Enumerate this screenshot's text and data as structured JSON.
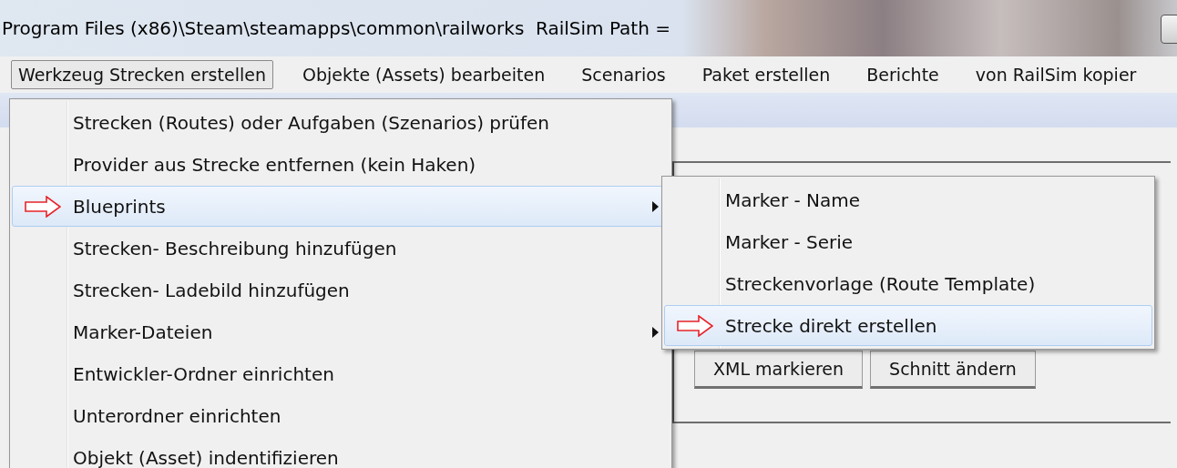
{
  "title_bar": {
    "title": "Program Files (x86)\\Steam\\steamapps\\common\\railworks  RailSim Path ="
  },
  "menu_bar": {
    "items": [
      {
        "label": "Werkzeug Strecken erstellen",
        "selected": true
      },
      {
        "label": "Objekte (Assets) bearbeiten",
        "selected": false
      },
      {
        "label": "Scenarios",
        "selected": false
      },
      {
        "label": "Paket erstellen",
        "selected": false
      },
      {
        "label": "Berichte",
        "selected": false
      },
      {
        "label": "von RailSim kopier",
        "selected": false
      }
    ]
  },
  "dropdown": {
    "items": [
      {
        "label": "Strecken (Routes) oder Aufgaben (Szenarios) prüfen",
        "kind": "command",
        "selected": false
      },
      {
        "label": "Provider aus Strecke entfernen (kein Haken)",
        "kind": "command",
        "selected": false
      },
      {
        "label": "Blueprints",
        "kind": "submenu",
        "selected": true
      },
      {
        "label": "Strecken- Beschreibung hinzufügen",
        "kind": "command",
        "selected": false
      },
      {
        "label": "Strecken- Ladebild hinzufügen",
        "kind": "command",
        "selected": false
      },
      {
        "label": "Marker-Dateien",
        "kind": "submenu",
        "selected": false
      },
      {
        "label": "Entwickler-Ordner einrichten",
        "kind": "command",
        "selected": false
      },
      {
        "label": "Unterordner einrichten",
        "kind": "command",
        "selected": false
      },
      {
        "label": "Objekt (Asset) indentifizieren",
        "kind": "command",
        "selected": false
      }
    ]
  },
  "submenu": {
    "items": [
      {
        "label": "Marker - Name",
        "selected": false
      },
      {
        "label": "Marker - Serie",
        "selected": false
      },
      {
        "label": "Streckenvorlage (Route Template)",
        "selected": false
      },
      {
        "label": "Strecke direkt erstellen",
        "selected": true
      }
    ]
  },
  "panel": {
    "buttons": [
      "XML markieren",
      "Schnitt ändern"
    ]
  }
}
